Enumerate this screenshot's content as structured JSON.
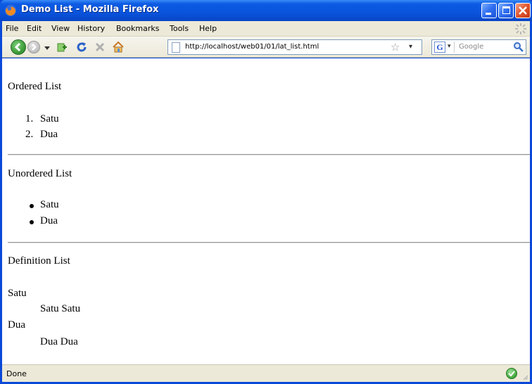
{
  "window": {
    "title": "Demo List - Mozilla Firefox"
  },
  "menubar": {
    "items": [
      "File",
      "Edit",
      "View",
      "History",
      "Bookmarks",
      "Tools",
      "Help"
    ]
  },
  "navbar": {
    "url": "http://localhost/web01/01/lat_list.html",
    "search_placeholder": "Google",
    "icons": [
      "back-icon",
      "forward-icon",
      "dropdown-icon",
      "bookmark-add-icon",
      "reload-icon",
      "stop-icon",
      "home-icon",
      "page-icon",
      "star-icon",
      "google-icon",
      "search-icon"
    ]
  },
  "page": {
    "ordered": {
      "heading": "Ordered List",
      "items": [
        {
          "marker": "1.",
          "text": "Satu"
        },
        {
          "marker": "2.",
          "text": "Dua"
        }
      ]
    },
    "unordered": {
      "heading": "Unordered List",
      "items": [
        "Satu",
        "Dua"
      ]
    },
    "definition": {
      "heading": "Definition List",
      "entries": [
        {
          "term": "Satu",
          "definition": "Satu Satu"
        },
        {
          "term": "Dua",
          "definition": "Dua Dua"
        }
      ]
    }
  },
  "statusbar": {
    "text": "Done"
  },
  "colors": {
    "titlebar": "#0a54dc",
    "chrome": "#ece9d8",
    "link_ok": "#3fa63a"
  }
}
